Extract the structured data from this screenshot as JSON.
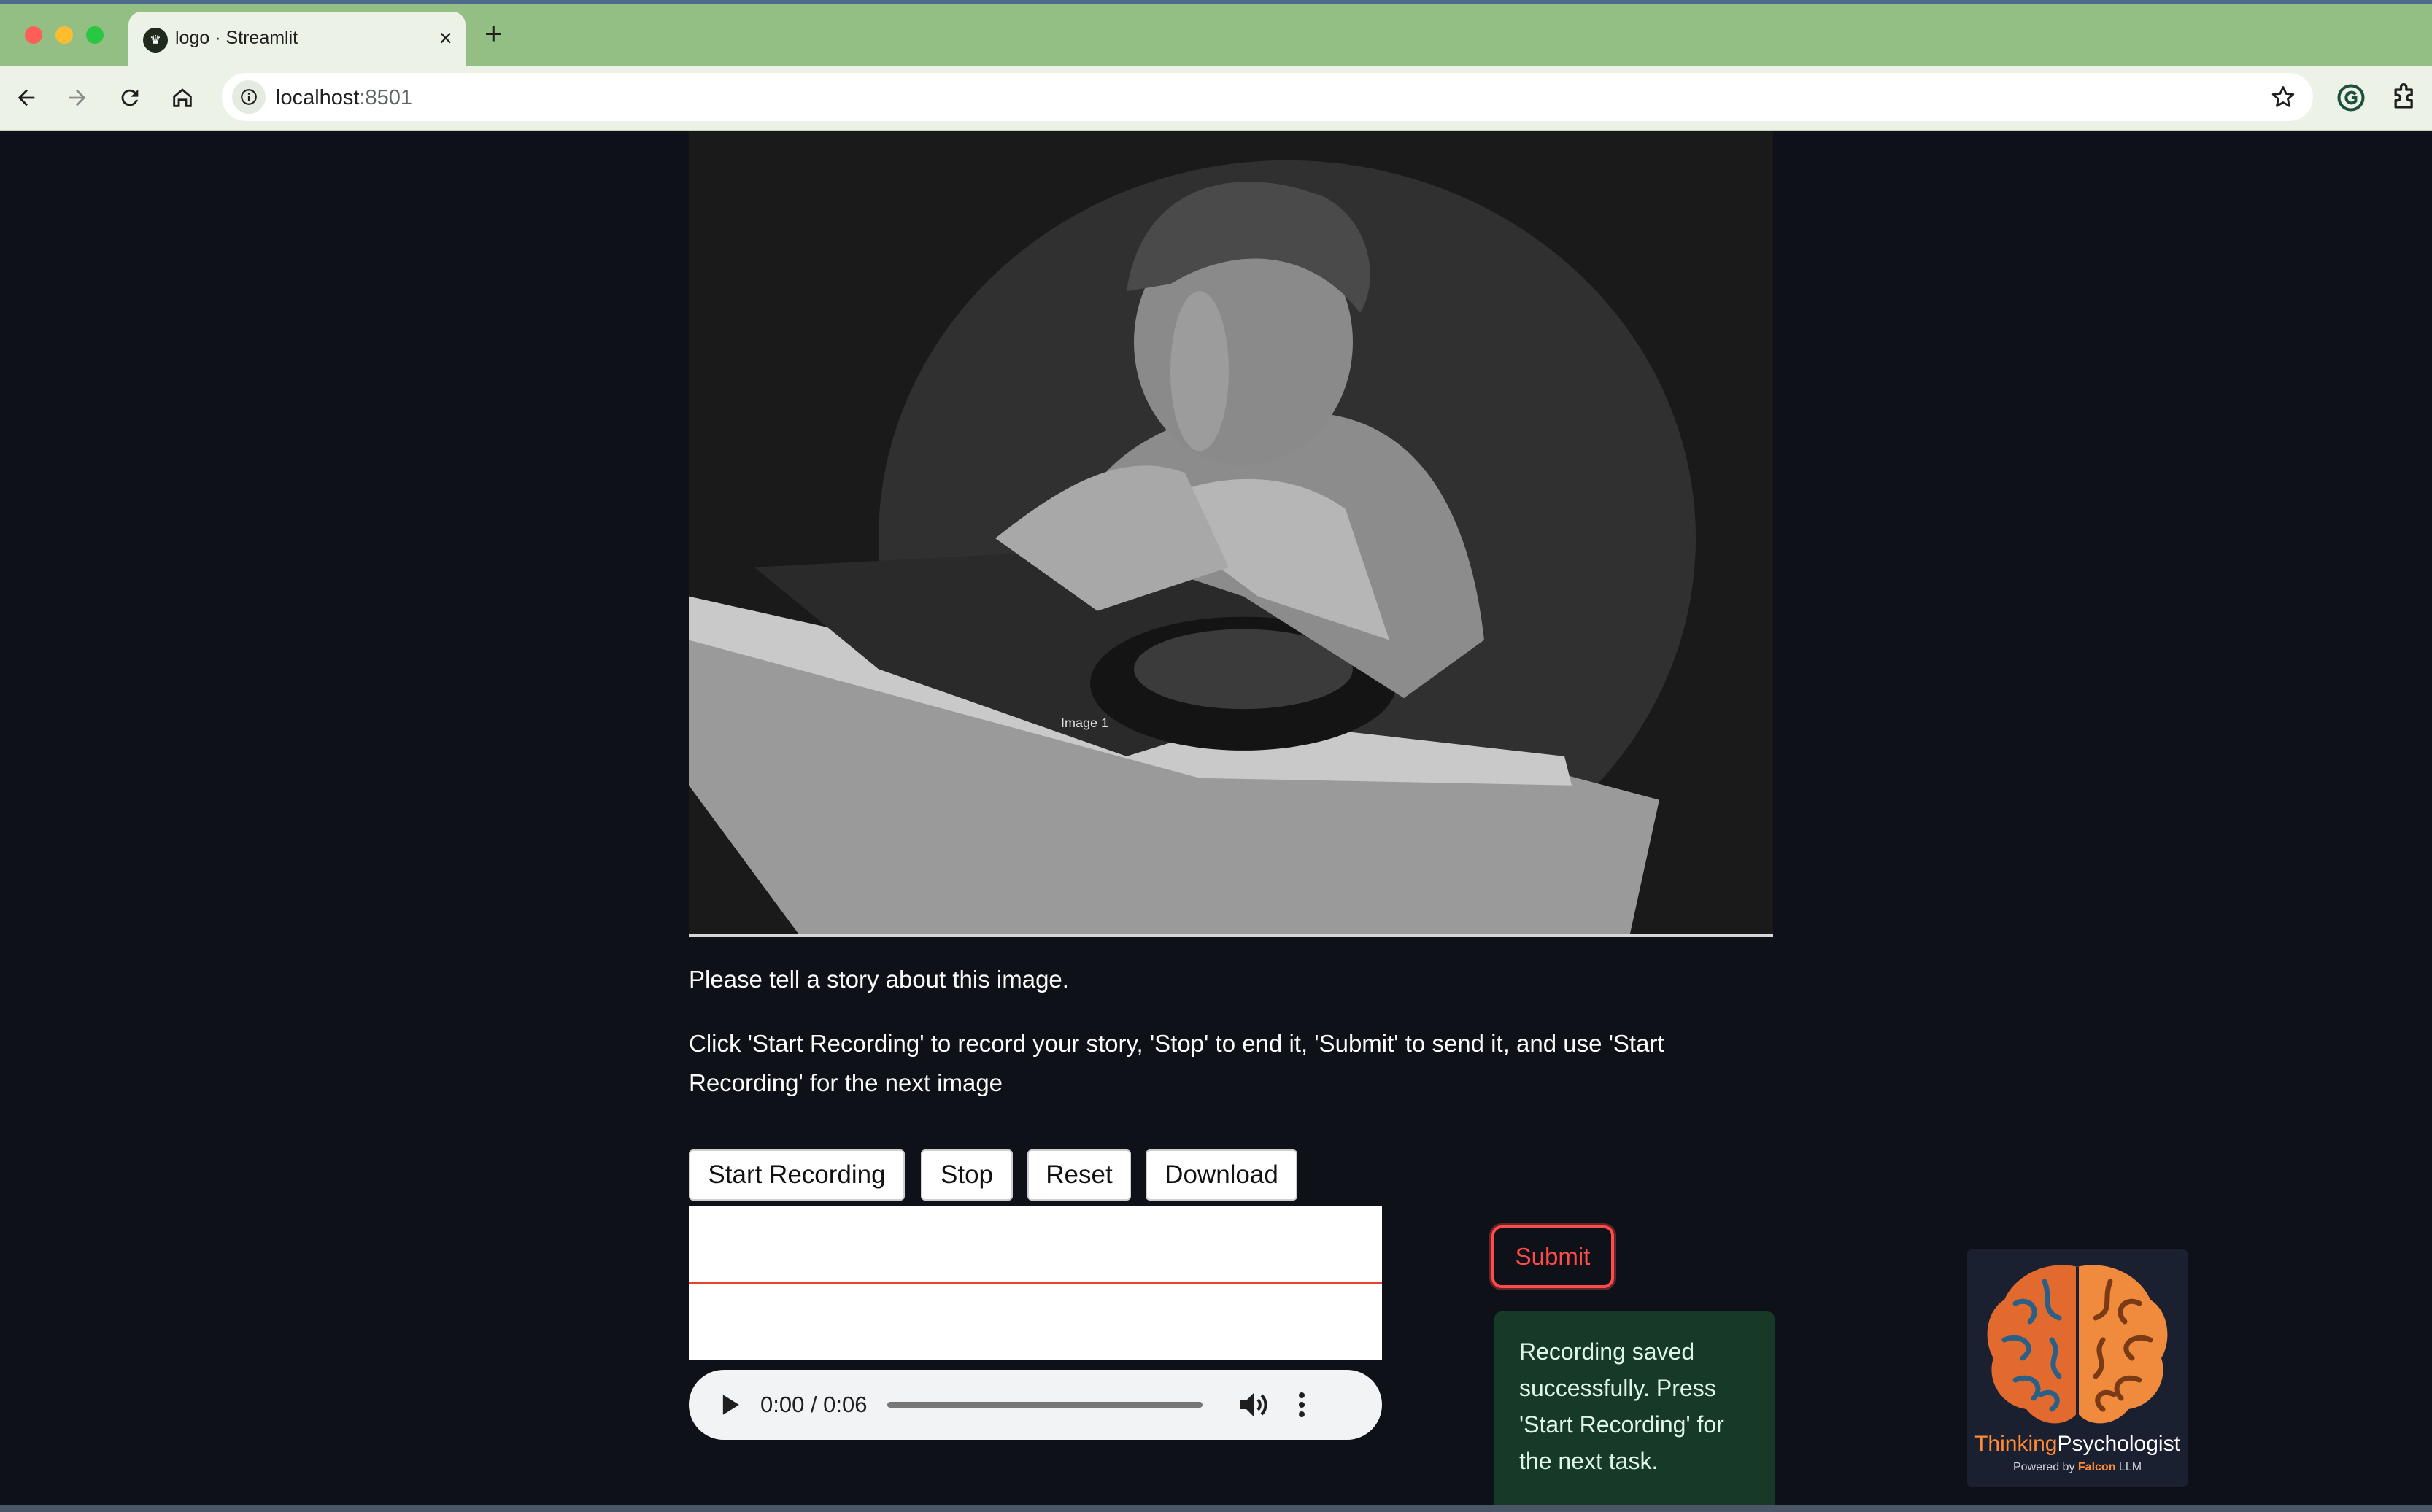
{
  "browser": {
    "tab_title": "logo · Streamlit",
    "url_host": "localhost",
    "url_port": ":8501"
  },
  "page": {
    "image_caption": "Image 1",
    "prompt": "Please tell a story about this image.",
    "instructions": "Click 'Start Recording' to record your story, 'Stop' to end it, 'Submit' to send it, and use 'Start Recording' for the next image"
  },
  "recorder": {
    "start_label": "Start Recording",
    "stop_label": "Stop",
    "reset_label": "Reset",
    "download_label": "Download"
  },
  "audio": {
    "time": "0:00 / 0:06",
    "progress_fraction": 0
  },
  "submit_label": "Submit",
  "status_message": "Recording saved successfully. Press 'Start Recording' for the next task.",
  "logo": {
    "brand_first": "Thinking",
    "brand_second": "Psychologist",
    "powered_prefix": "Powered by",
    "powered_brand": "Falcon",
    "powered_suffix": "LLM"
  },
  "colors": {
    "page_background": "#0e1117",
    "accent_red": "#ff4b4b",
    "success_background": "#173928",
    "browser_frame": "#93bf85"
  }
}
